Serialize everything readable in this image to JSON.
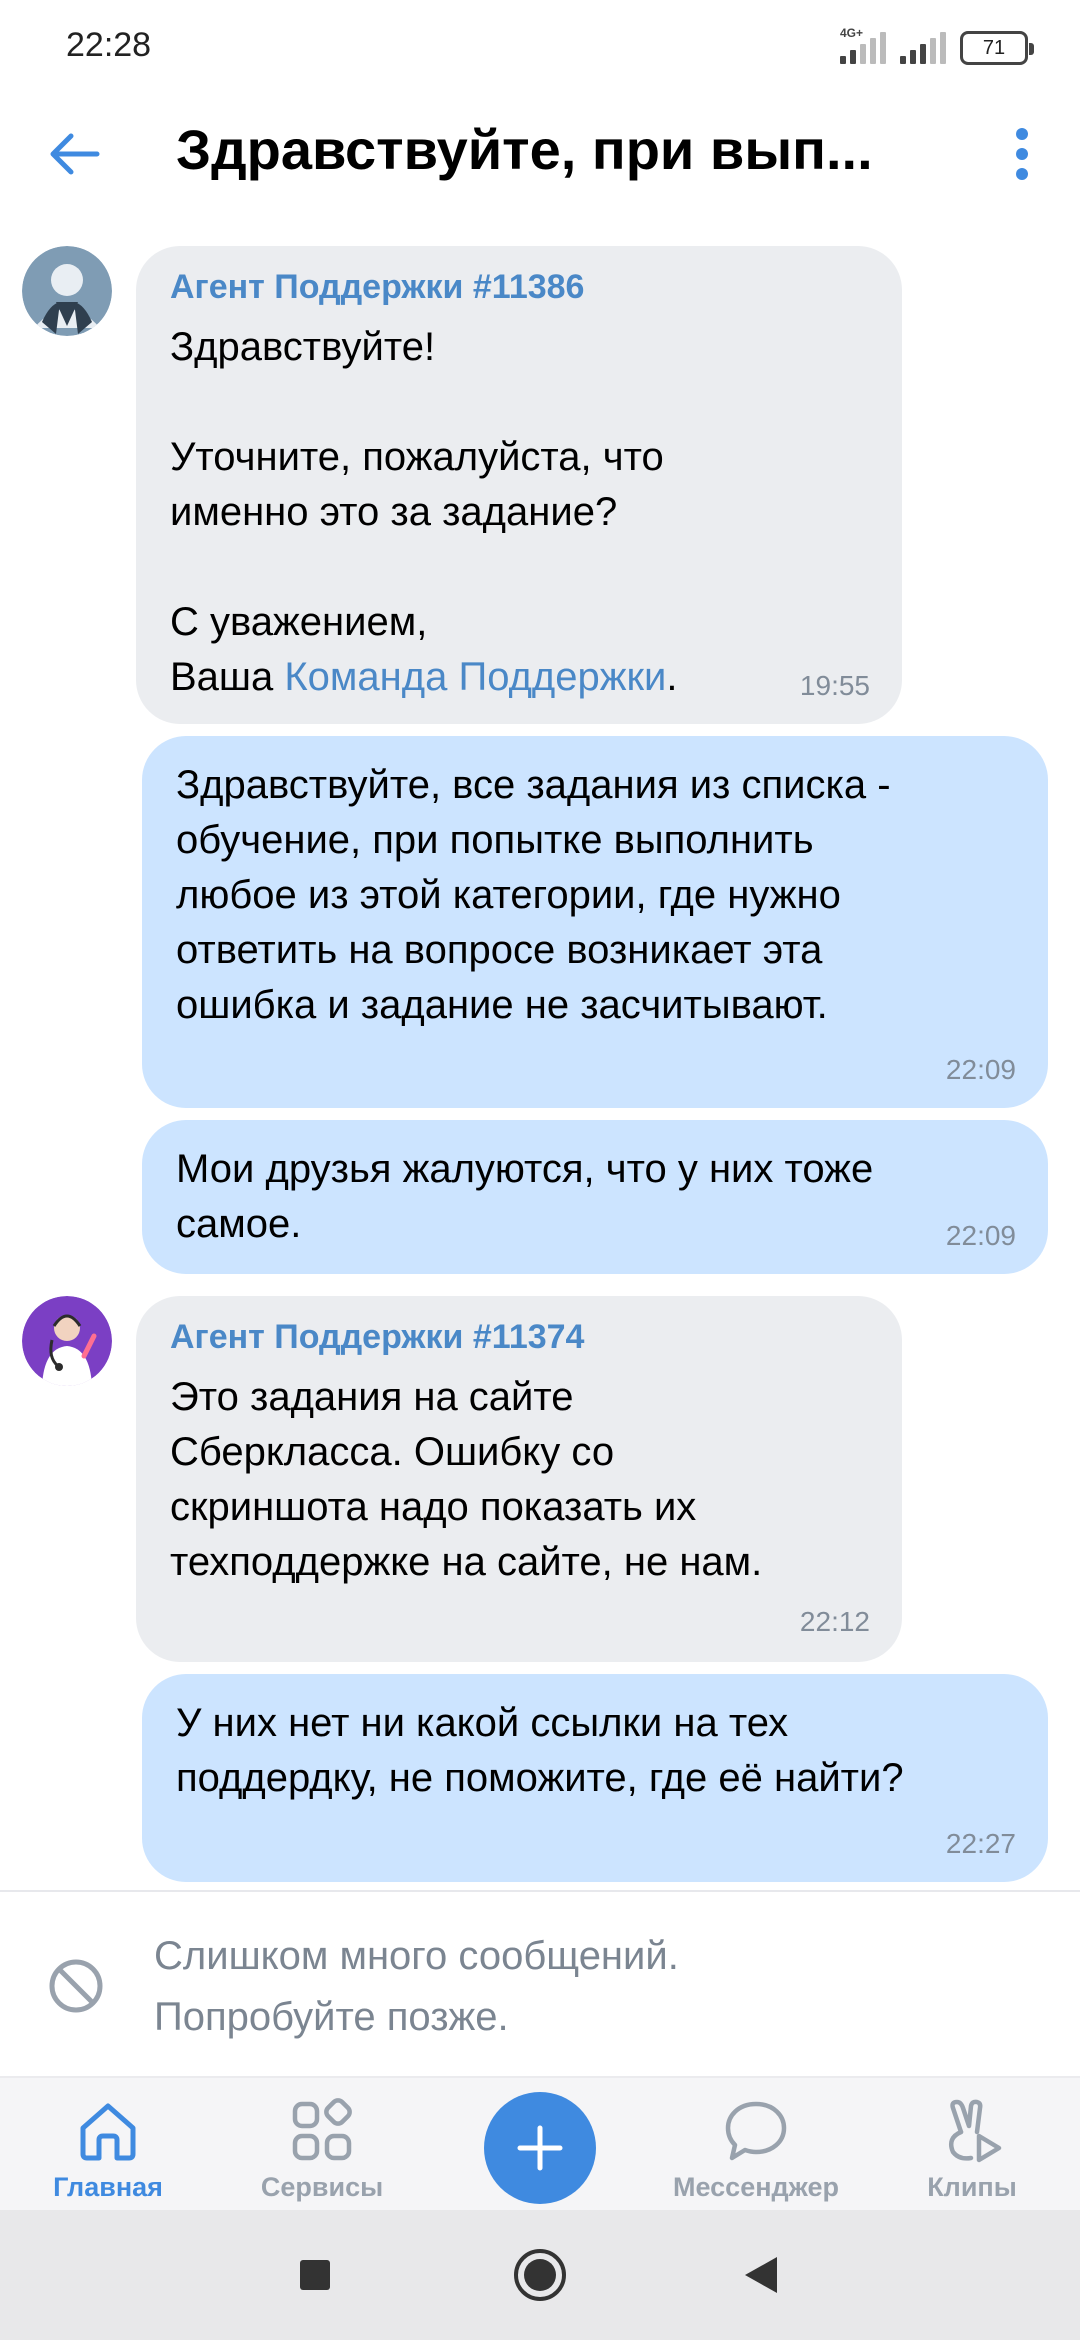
{
  "status_bar": {
    "time": "22:28",
    "network_tag": "4G+",
    "battery": "71"
  },
  "header": {
    "title": "Здравствуйте, при вып...",
    "back_icon": "arrow-left-icon",
    "more_icon": "more-vertical-icon"
  },
  "messages": [
    {
      "direction": "in",
      "sender": "Агент Поддержки #11386",
      "text_before_link": "Здравствуйте!\n\nУточните, пожалуйста, что\nименно это за задание?\n\nС уважением,\nВаша ",
      "link_text": "Команда Поддержки",
      "text_after_link": ".",
      "time": "19:55"
    },
    {
      "direction": "out",
      "text": "Здравствуйте, все задания из списка -\nобучение, при попытке выполнить\nлюбое из этой категории, где нужно\nответить на вопросе возникает эта\nошибка и задание не засчитывают.",
      "time": "22:09"
    },
    {
      "direction": "out",
      "text": "Мои друзья жалуются, что у них тоже\nсамое.",
      "time": "22:09"
    },
    {
      "direction": "in",
      "sender": "Агент Поддержки #11374",
      "text": "Это задания на сайте\nСберкласса. Ошибку со\nскриншота надо показать их\nтехподдержке на сайте, не нам.",
      "time": "22:12"
    },
    {
      "direction": "out",
      "text": "У них нет ни какой ссылки на тех\nподдердку, не поможите, где её найти?",
      "time": "22:27"
    }
  ],
  "composer": {
    "blocked_text": "Слишком много сообщений.\nПопробуйте позже.",
    "icon": "blocked-icon"
  },
  "bottom_nav": {
    "items": [
      {
        "label": "Главная",
        "icon": "home-icon",
        "active": true
      },
      {
        "label": "Сервисы",
        "icon": "services-icon",
        "active": false
      },
      {
        "label": "",
        "icon": "plus-icon",
        "active": false
      },
      {
        "label": "Мессенджер",
        "icon": "messenger-icon",
        "active": false
      },
      {
        "label": "Клипы",
        "icon": "clips-icon",
        "active": false
      }
    ]
  },
  "colors": {
    "accent": "#3f8ae0",
    "incoming_bubble": "#ebedf0",
    "outgoing_bubble": "#cce4ff",
    "sender_name": "#4a88c7",
    "time_text": "#818c99"
  }
}
